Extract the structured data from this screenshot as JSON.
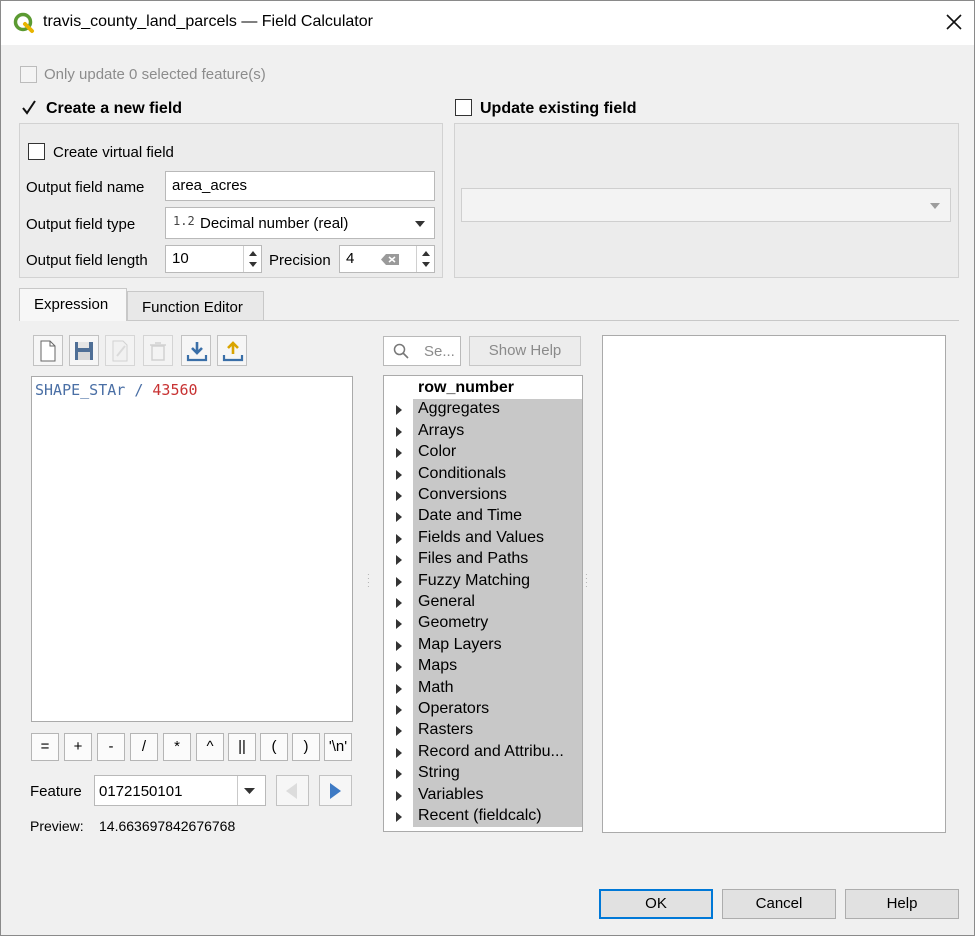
{
  "window": {
    "title": "travis_county_land_parcels — Field Calculator",
    "icon": "qgis-logo-icon"
  },
  "options": {
    "only_update_selected": "Only update 0 selected feature(s)",
    "create_new_field": "Create a new field",
    "update_existing_field": "Update existing field",
    "create_virtual_field": "Create virtual field"
  },
  "new_field": {
    "name_label": "Output field name",
    "name_value": "area_acres",
    "type_label": "Output field type",
    "type_badge": "1.2",
    "type_value": "Decimal number (real)",
    "length_label": "Output field length",
    "length_value": "10",
    "precision_label": "Precision",
    "precision_value": "4"
  },
  "tabs": [
    "Expression",
    "Function Editor"
  ],
  "expression": {
    "field": "SHAPE_STAr",
    "operator": "/",
    "number": "43560"
  },
  "operators": [
    "=",
    "+",
    "-",
    "/",
    "*",
    "^",
    "||",
    "(",
    ")",
    "'\\n'"
  ],
  "feature": {
    "label": "Feature",
    "value": "0172150101"
  },
  "preview": {
    "label": "Preview:",
    "value": "14.663697842676768"
  },
  "function_panel": {
    "search_placeholder": "Se...",
    "show_help": "Show Help",
    "items": [
      {
        "label": "row_number",
        "expandable": false
      },
      {
        "label": "Aggregates",
        "expandable": true
      },
      {
        "label": "Arrays",
        "expandable": true
      },
      {
        "label": "Color",
        "expandable": true
      },
      {
        "label": "Conditionals",
        "expandable": true
      },
      {
        "label": "Conversions",
        "expandable": true
      },
      {
        "label": "Date and Time",
        "expandable": true
      },
      {
        "label": "Fields and Values",
        "expandable": true
      },
      {
        "label": "Files and Paths",
        "expandable": true
      },
      {
        "label": "Fuzzy Matching",
        "expandable": true
      },
      {
        "label": "General",
        "expandable": true
      },
      {
        "label": "Geometry",
        "expandable": true
      },
      {
        "label": "Map Layers",
        "expandable": true
      },
      {
        "label": "Maps",
        "expandable": true
      },
      {
        "label": "Math",
        "expandable": true
      },
      {
        "label": "Operators",
        "expandable": true
      },
      {
        "label": "Rasters",
        "expandable": true
      },
      {
        "label": "Record and Attribu...",
        "expandable": true
      },
      {
        "label": "String",
        "expandable": true
      },
      {
        "label": "Variables",
        "expandable": true
      },
      {
        "label": "Recent (fieldcalc)",
        "expandable": true
      }
    ]
  },
  "footer": {
    "ok": "OK",
    "cancel": "Cancel",
    "help": "Help"
  },
  "colors": {
    "expr_field": "#4a6fa5",
    "expr_number": "#c83232",
    "accent": "#0078d7"
  }
}
